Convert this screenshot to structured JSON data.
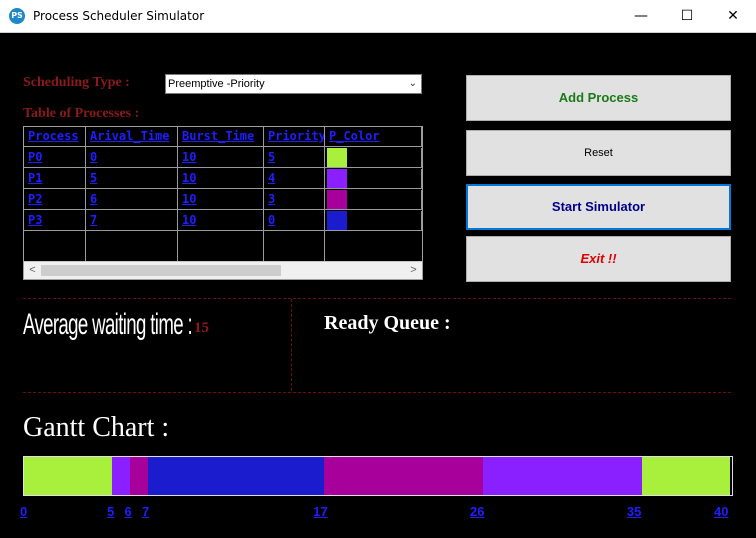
{
  "window": {
    "title": "Process Scheduler Simulator",
    "icon_text": "PS",
    "minimize_glyph": "—",
    "maximize_glyph": "☐",
    "close_glyph": "✕"
  },
  "scheduling": {
    "label": "Scheduling Type :",
    "selected": "Preemptive -Priority",
    "chevron": "⌄"
  },
  "table": {
    "label": "Table of Processes :",
    "columns": [
      "Process",
      "Arival_Time",
      "Burst_Time",
      "Priority",
      "P_Color"
    ],
    "rows": [
      {
        "process": "P0",
        "arrival": "0",
        "burst": "10",
        "priority": "5",
        "color": "#a8f03c"
      },
      {
        "process": "P1",
        "arrival": "5",
        "burst": "10",
        "priority": "4",
        "color": "#8a1fff"
      },
      {
        "process": "P2",
        "arrival": "6",
        "burst": "10",
        "priority": "3",
        "color": "#a8009a"
      },
      {
        "process": "P3",
        "arrival": "7",
        "burst": "10",
        "priority": "0",
        "color": "#1c1ccf"
      }
    ],
    "scroll_left": "<",
    "scroll_right": ">"
  },
  "buttons": {
    "add": "Add Process",
    "reset": "Reset",
    "start": "Start Simulator",
    "exit": "Exit !!"
  },
  "stats": {
    "awt_label": "Average waiting time :",
    "awt_value": "15",
    "ready_queue_label": "Ready Queue :"
  },
  "gantt": {
    "label": "Gantt Chart :",
    "total_time": 40,
    "segments": [
      {
        "start": 0,
        "end": 5,
        "color": "#a8f03c"
      },
      {
        "start": 5,
        "end": 6,
        "color": "#8a1fff"
      },
      {
        "start": 6,
        "end": 7,
        "color": "#a8009a"
      },
      {
        "start": 7,
        "end": 17,
        "color": "#1c1ccf"
      },
      {
        "start": 17,
        "end": 26,
        "color": "#a8009a"
      },
      {
        "start": 26,
        "end": 35,
        "color": "#8a1fff"
      },
      {
        "start": 35,
        "end": 40,
        "color": "#a8f03c"
      }
    ],
    "ticks": [
      "0",
      "5",
      "6",
      "7",
      "17",
      "26",
      "35",
      "40"
    ]
  }
}
